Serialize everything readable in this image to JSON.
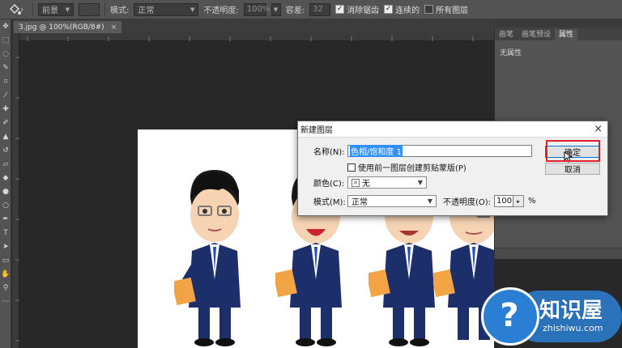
{
  "options_bar": {
    "fill_source": "前景",
    "mode_label": "模式:",
    "mode_value": "正常",
    "opacity_label": "不透明度:",
    "opacity_value": "100%",
    "tolerance_label": "容差:",
    "tolerance_value": "32",
    "antialias_label": "消除锯齿",
    "contiguous_label": "连续的",
    "all_layers_label": "所有图层"
  },
  "document": {
    "tab_title": "3.jpg @ 100%(RGB/8#)",
    "close_glyph": "×"
  },
  "panel": {
    "tabs": [
      "画笔",
      "画笔预设",
      "属性"
    ],
    "active_tab": "属性",
    "body_text": "无属性"
  },
  "dialog": {
    "title": "新建图层",
    "close_glyph": "×",
    "name_label": "名称(N):",
    "name_value": "色相/饱和度 1",
    "clip_label": "使用前一图层创建剪贴蒙版(P)",
    "color_label": "颜色(C):",
    "color_value": "无",
    "mode_label": "模式(M):",
    "mode_value": "正常",
    "opacity_label": "不透明度(O):",
    "opacity_value": "100",
    "opacity_unit": "%",
    "ok_label": "确定",
    "cancel_label": "取消"
  },
  "watermark": {
    "brand": "知识屋",
    "domain": "zhishiwu.com",
    "glyph": "?"
  },
  "colors": {
    "highlight": "#e0202a",
    "watermark_blue": "#2a7fd4",
    "selection": "#3390ff"
  }
}
